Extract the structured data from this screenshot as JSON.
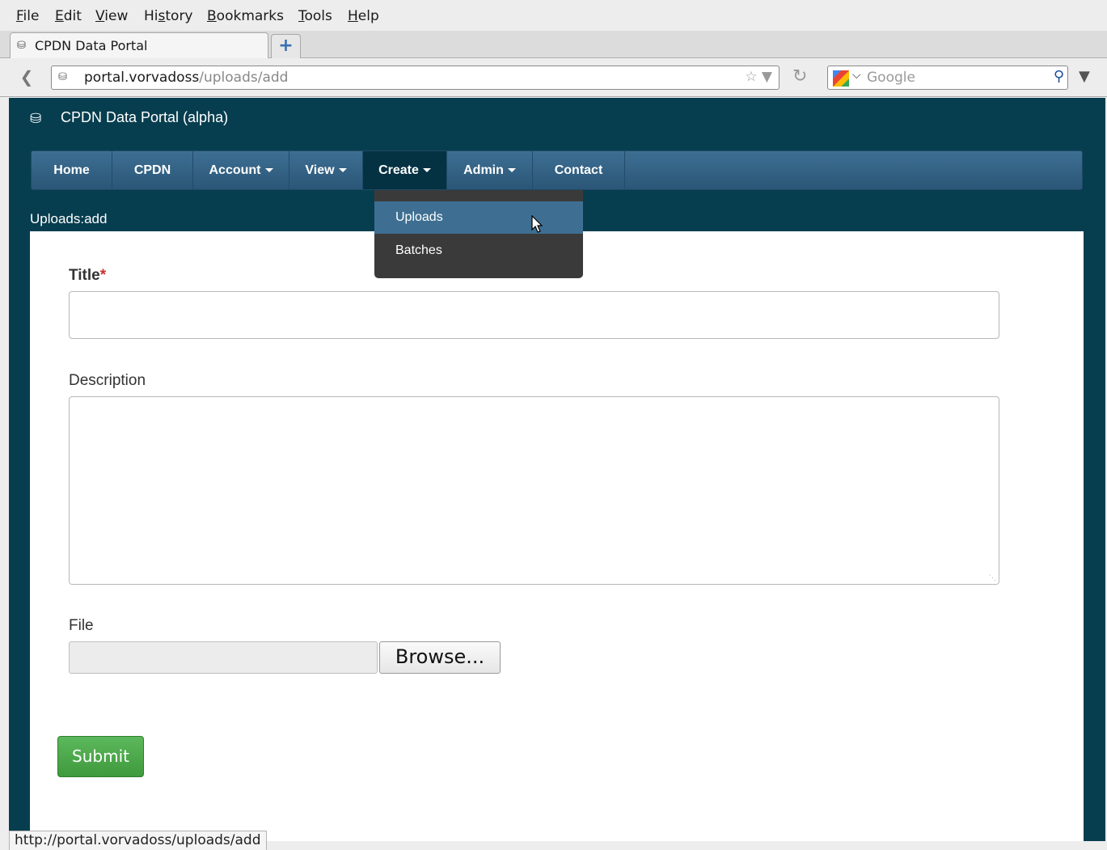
{
  "browser": {
    "menus": [
      "File",
      "Edit",
      "View",
      "History",
      "Bookmarks",
      "Tools",
      "Help"
    ],
    "tab_title": "CPDN Data Portal",
    "new_tab_icon": "plus-icon",
    "url_host": "portal.vorvadoss",
    "url_path": "/uploads/add",
    "search_placeholder": "Google",
    "status_url": "http://portal.vorvadoss/uploads/add"
  },
  "site": {
    "brand": "CPDN Data Portal (alpha)",
    "brand_icon": "database-icon",
    "nav": [
      {
        "label": "Home",
        "dropdown": false
      },
      {
        "label": "CPDN",
        "dropdown": false
      },
      {
        "label": "Account",
        "dropdown": true
      },
      {
        "label": "View",
        "dropdown": true
      },
      {
        "label": "Create",
        "dropdown": true,
        "active": true
      },
      {
        "label": "Admin",
        "dropdown": true
      },
      {
        "label": "Contact",
        "dropdown": false
      }
    ],
    "create_menu": [
      "Uploads",
      "Batches"
    ],
    "breadcrumb": "Uploads:add"
  },
  "form": {
    "title_label": "Title",
    "required_marker": "*",
    "title_value": "",
    "description_label": "Description",
    "description_value": "",
    "file_label": "File",
    "browse_label": "Browse...",
    "submit_label": "Submit"
  },
  "colors": {
    "page_background": "#073e4f",
    "nav_bar": "#2b5677",
    "submit_green": "#5cb85c",
    "required_red": "#c9302c"
  }
}
